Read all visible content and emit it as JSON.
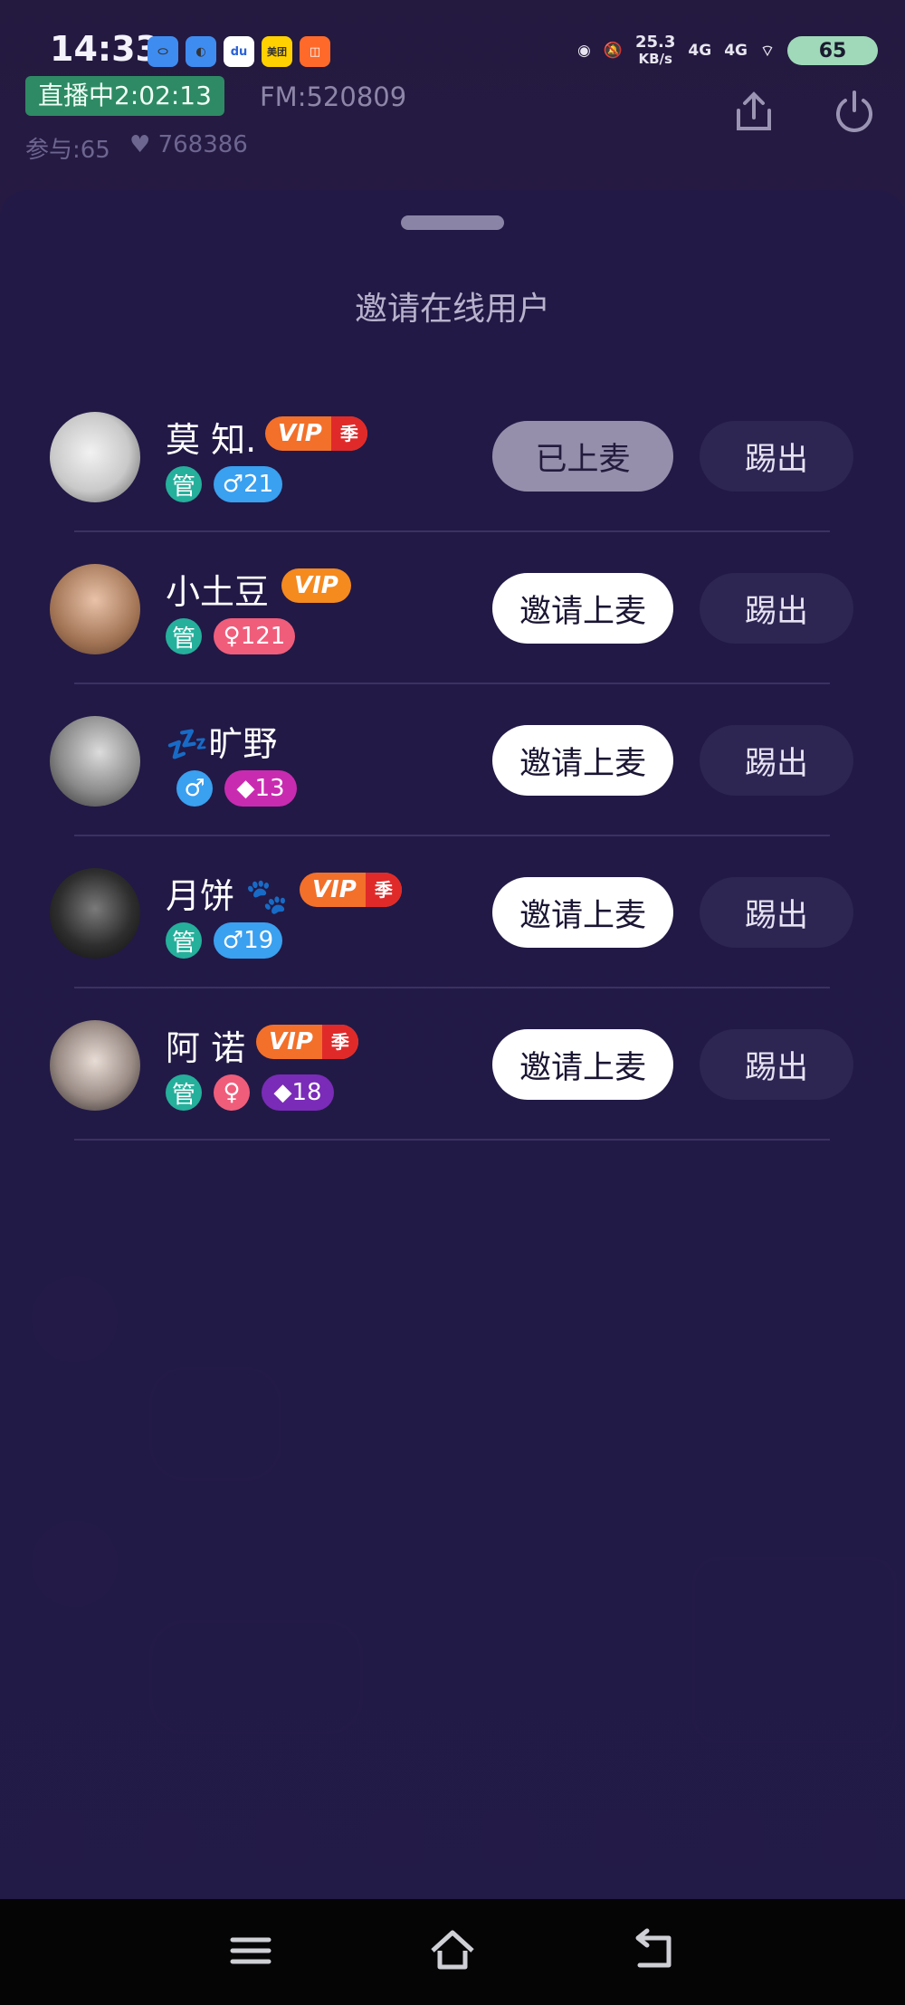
{
  "status_bar": {
    "time": "14:33",
    "net_speed": "25.3",
    "net_unit": "KB/s",
    "signal1": "4G",
    "signal2": "4G",
    "battery": "65",
    "apps": [
      "app-a",
      "app-b",
      "du",
      "美团",
      "app-e"
    ]
  },
  "room": {
    "live_badge": "直播中2:02:13",
    "fm": "FM:520809",
    "participants": "参与:65",
    "likes": "768386"
  },
  "sheet": {
    "title": "邀请在线用户",
    "users": [
      {
        "name": "莫 知.",
        "vip": "VIP",
        "vip_season": "季",
        "admin": "管",
        "gender": "♂",
        "level": "21",
        "action": "已上麦",
        "kick": "踢出"
      },
      {
        "name": "小土豆",
        "vip": "VIP",
        "admin": "管",
        "gender": "♀",
        "level": "121",
        "action": "邀请上麦",
        "kick": "踢出"
      },
      {
        "name": "💤旷野",
        "gender": "♂",
        "level": "13",
        "action": "邀请上麦",
        "kick": "踢出"
      },
      {
        "name": "月饼 🐾",
        "vip": "VIP",
        "vip_season": "季",
        "admin": "管",
        "gender": "♂",
        "level": "19",
        "action": "邀请上麦",
        "kick": "踢出"
      },
      {
        "name": "阿 诺",
        "vip": "VIP",
        "vip_season": "季",
        "admin": "管",
        "gender": "♀",
        "level": "18",
        "action": "邀请上麦",
        "kick": "踢出"
      }
    ]
  },
  "colors": {
    "admin_badge": "#25b09c",
    "male_badge": "#3aa0f0",
    "female_badge": "#f05d7b",
    "level_pink": "#c92bb0",
    "level_purple": "#7a2bb8",
    "vip_orange": "#f3702a"
  }
}
